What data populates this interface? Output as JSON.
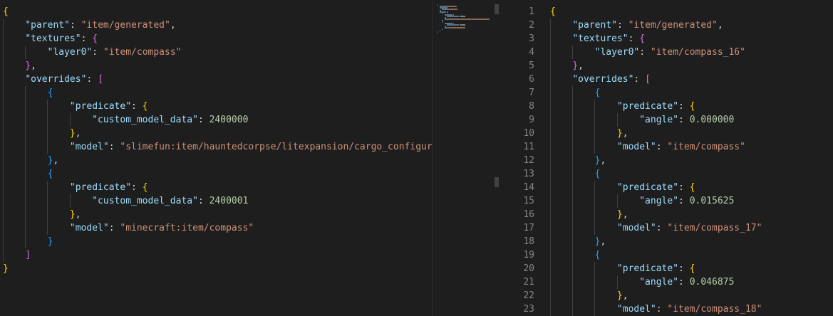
{
  "left_editor": {
    "lines": [
      [
        [
          "b1",
          "{"
        ]
      ],
      [
        [
          "tok-punc",
          "    "
        ],
        [
          "tok-key",
          "\"parent\""
        ],
        [
          "tok-punc",
          ": "
        ],
        [
          "tok-str",
          "\"item/generated\""
        ],
        [
          "tok-punc",
          ","
        ]
      ],
      [
        [
          "tok-punc",
          "    "
        ],
        [
          "tok-key",
          "\"textures\""
        ],
        [
          "tok-punc",
          ": "
        ],
        [
          "b2",
          "{"
        ]
      ],
      [
        [
          "tok-punc",
          "        "
        ],
        [
          "tok-key",
          "\"layer0\""
        ],
        [
          "tok-punc",
          ": "
        ],
        [
          "tok-str",
          "\"item/compass\""
        ]
      ],
      [
        [
          "tok-punc",
          "    "
        ],
        [
          "b2",
          "}"
        ],
        [
          "tok-punc",
          ","
        ]
      ],
      [
        [
          "tok-punc",
          "    "
        ],
        [
          "tok-key",
          "\"overrides\""
        ],
        [
          "tok-punc",
          ": "
        ],
        [
          "b2",
          "["
        ]
      ],
      [
        [
          "tok-punc",
          "        "
        ],
        [
          "b3",
          "{"
        ]
      ],
      [
        [
          "tok-punc",
          "            "
        ],
        [
          "tok-key",
          "\"predicate\""
        ],
        [
          "tok-punc",
          ": "
        ],
        [
          "b1",
          "{"
        ]
      ],
      [
        [
          "tok-punc",
          "                "
        ],
        [
          "tok-key",
          "\"custom_model_data\""
        ],
        [
          "tok-punc",
          ": "
        ],
        [
          "tok-num",
          "2400000"
        ]
      ],
      [
        [
          "tok-punc",
          "            "
        ],
        [
          "b1",
          "}"
        ],
        [
          "tok-punc",
          ","
        ]
      ],
      [
        [
          "tok-punc",
          "            "
        ],
        [
          "tok-key",
          "\"model\""
        ],
        [
          "tok-punc",
          ": "
        ],
        [
          "tok-str",
          "\"slimefun:item/hauntedcorpse/litexpansion/cargo_configurator\""
        ]
      ],
      [
        [
          "tok-punc",
          "        "
        ],
        [
          "b3",
          "}"
        ],
        [
          "tok-punc",
          ","
        ]
      ],
      [
        [
          "tok-punc",
          "        "
        ],
        [
          "b3",
          "{"
        ]
      ],
      [
        [
          "tok-punc",
          "            "
        ],
        [
          "tok-key",
          "\"predicate\""
        ],
        [
          "tok-punc",
          ": "
        ],
        [
          "b1",
          "{"
        ]
      ],
      [
        [
          "tok-punc",
          "                "
        ],
        [
          "tok-key",
          "\"custom_model_data\""
        ],
        [
          "tok-punc",
          ": "
        ],
        [
          "tok-num",
          "2400001"
        ]
      ],
      [
        [
          "tok-punc",
          "            "
        ],
        [
          "b1",
          "}"
        ],
        [
          "tok-punc",
          ","
        ]
      ],
      [
        [
          "tok-punc",
          "            "
        ],
        [
          "tok-key",
          "\"model\""
        ],
        [
          "tok-punc",
          ": "
        ],
        [
          "tok-str",
          "\"minecraft:item/compass\""
        ]
      ],
      [
        [
          "tok-punc",
          "        "
        ],
        [
          "b3",
          "}"
        ]
      ],
      [
        [
          "tok-punc",
          "    "
        ],
        [
          "b2",
          "]"
        ]
      ],
      [
        [
          "b1",
          "}"
        ]
      ]
    ]
  },
  "right_editor": {
    "line_numbers": [
      "1",
      "2",
      "3",
      "4",
      "5",
      "6",
      "7",
      "8",
      "9",
      "10",
      "11",
      "12",
      "13",
      "14",
      "15",
      "16",
      "17",
      "18",
      "19",
      "20",
      "21",
      "22",
      "23"
    ],
    "lines": [
      [
        [
          "b1",
          "{"
        ]
      ],
      [
        [
          "tok-punc",
          "    "
        ],
        [
          "tok-key",
          "\"parent\""
        ],
        [
          "tok-punc",
          ": "
        ],
        [
          "tok-str",
          "\"item/generated\""
        ],
        [
          "tok-punc",
          ","
        ]
      ],
      [
        [
          "tok-punc",
          "    "
        ],
        [
          "tok-key",
          "\"textures\""
        ],
        [
          "tok-punc",
          ": "
        ],
        [
          "b2",
          "{"
        ]
      ],
      [
        [
          "tok-punc",
          "        "
        ],
        [
          "tok-key",
          "\"layer0\""
        ],
        [
          "tok-punc",
          ": "
        ],
        [
          "tok-str",
          "\"item/compass_16\""
        ]
      ],
      [
        [
          "tok-punc",
          "    "
        ],
        [
          "b2",
          "}"
        ],
        [
          "tok-punc",
          ","
        ]
      ],
      [
        [
          "tok-punc",
          "    "
        ],
        [
          "tok-key",
          "\"overrides\""
        ],
        [
          "tok-punc",
          ": "
        ],
        [
          "b2",
          "["
        ]
      ],
      [
        [
          "tok-punc",
          "        "
        ],
        [
          "b3",
          "{"
        ]
      ],
      [
        [
          "tok-punc",
          "            "
        ],
        [
          "tok-key",
          "\"predicate\""
        ],
        [
          "tok-punc",
          ": "
        ],
        [
          "b1",
          "{"
        ]
      ],
      [
        [
          "tok-punc",
          "                "
        ],
        [
          "tok-key",
          "\"angle\""
        ],
        [
          "tok-punc",
          ": "
        ],
        [
          "tok-num",
          "0.000000"
        ]
      ],
      [
        [
          "tok-punc",
          "            "
        ],
        [
          "b1",
          "}"
        ],
        [
          "tok-punc",
          ","
        ]
      ],
      [
        [
          "tok-punc",
          "            "
        ],
        [
          "tok-key",
          "\"model\""
        ],
        [
          "tok-punc",
          ": "
        ],
        [
          "tok-str",
          "\"item/compass\""
        ]
      ],
      [
        [
          "tok-punc",
          "        "
        ],
        [
          "b3",
          "}"
        ],
        [
          "tok-punc",
          ","
        ]
      ],
      [
        [
          "tok-punc",
          "        "
        ],
        [
          "b3",
          "{"
        ]
      ],
      [
        [
          "tok-punc",
          "            "
        ],
        [
          "tok-key",
          "\"predicate\""
        ],
        [
          "tok-punc",
          ": "
        ],
        [
          "b1",
          "{"
        ]
      ],
      [
        [
          "tok-punc",
          "                "
        ],
        [
          "tok-key",
          "\"angle\""
        ],
        [
          "tok-punc",
          ": "
        ],
        [
          "tok-num",
          "0.015625"
        ]
      ],
      [
        [
          "tok-punc",
          "            "
        ],
        [
          "b1",
          "}"
        ],
        [
          "tok-punc",
          ","
        ]
      ],
      [
        [
          "tok-punc",
          "            "
        ],
        [
          "tok-key",
          "\"model\""
        ],
        [
          "tok-punc",
          ": "
        ],
        [
          "tok-str",
          "\"item/compass_17\""
        ]
      ],
      [
        [
          "tok-punc",
          "        "
        ],
        [
          "b3",
          "}"
        ],
        [
          "tok-punc",
          ","
        ]
      ],
      [
        [
          "tok-punc",
          "        "
        ],
        [
          "b3",
          "{"
        ]
      ],
      [
        [
          "tok-punc",
          "            "
        ],
        [
          "tok-key",
          "\"predicate\""
        ],
        [
          "tok-punc",
          ": "
        ],
        [
          "b1",
          "{"
        ]
      ],
      [
        [
          "tok-punc",
          "                "
        ],
        [
          "tok-key",
          "\"angle\""
        ],
        [
          "tok-punc",
          ": "
        ],
        [
          "tok-num",
          "0.046875"
        ]
      ],
      [
        [
          "tok-punc",
          "            "
        ],
        [
          "b1",
          "}"
        ],
        [
          "tok-punc",
          ","
        ]
      ],
      [
        [
          "tok-punc",
          "            "
        ],
        [
          "tok-key",
          "\"model\""
        ],
        [
          "tok-punc",
          ": "
        ],
        [
          "tok-str",
          "\"item/compass_18\""
        ]
      ]
    ]
  },
  "colors": {
    "background": "#1e1e1e",
    "key": "#9cdcfe",
    "string": "#ce9178",
    "number": "#b5cea8",
    "bracket_gold": "#ffd700",
    "bracket_purple": "#da70d6",
    "bracket_blue": "#179fff",
    "line_number": "#858585"
  }
}
